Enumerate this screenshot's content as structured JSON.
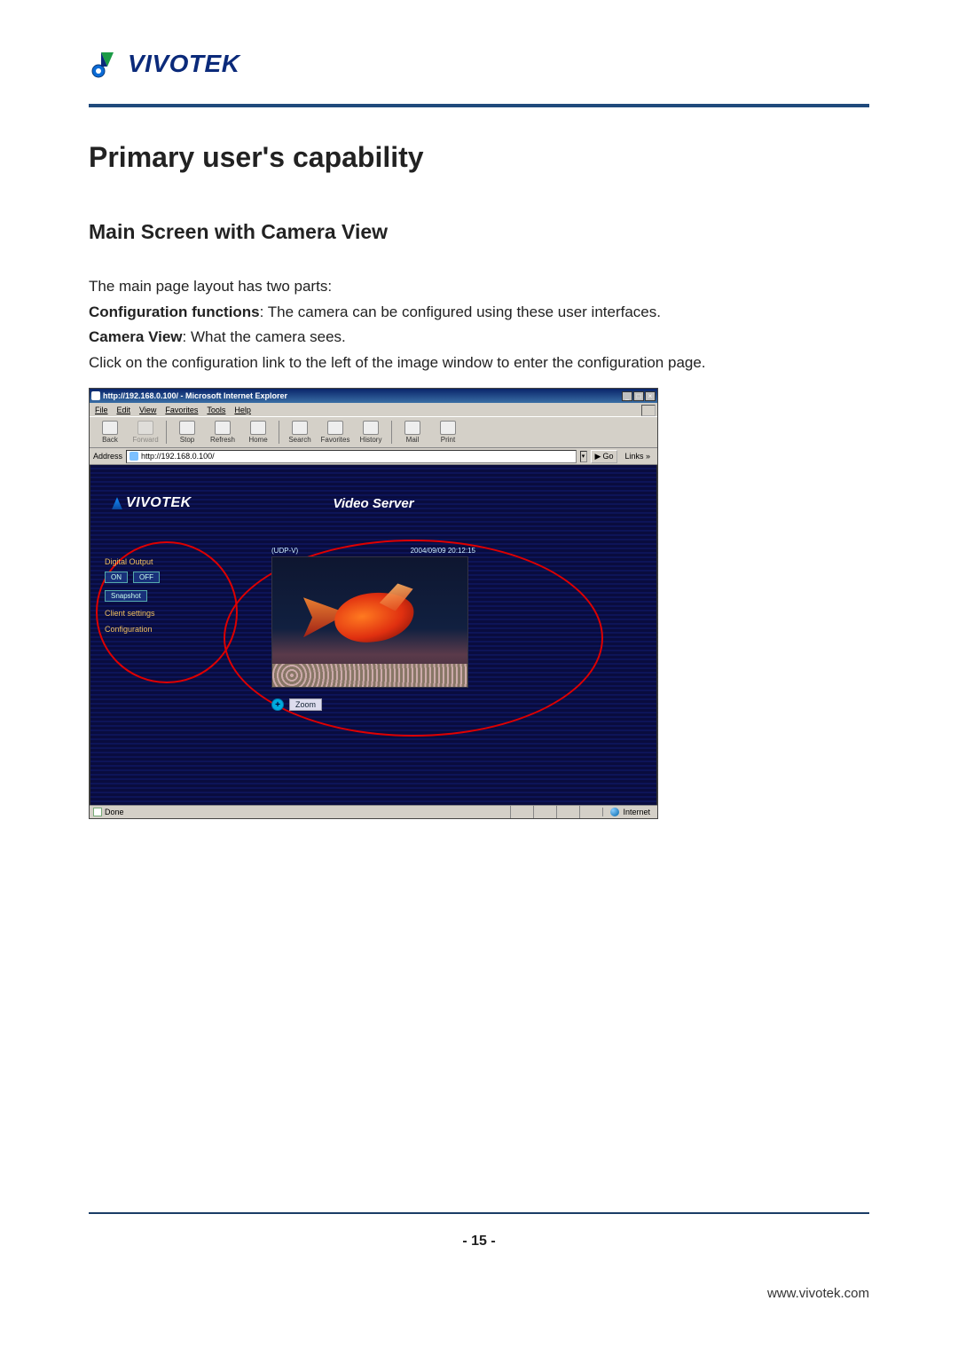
{
  "logo": {
    "text": "VIVOTEK"
  },
  "h1": "Primary user's capability",
  "h2": "Main Screen with Camera View",
  "body": {
    "p1": "The main page layout has two parts:",
    "cf_label": "Configuration functions",
    "cf_text": ": The camera can be configured using these user interfaces.",
    "cv_label": "Camera View",
    "cv_text": ": What the camera sees.",
    "p2": "Click on the configuration link to the left of the image window to enter the configuration page."
  },
  "screenshot": {
    "title": "http://192.168.0.100/ - Microsoft Internet Explorer",
    "menubar": [
      "File",
      "Edit",
      "View",
      "Favorites",
      "Tools",
      "Help"
    ],
    "toolbar": [
      {
        "label": "Back",
        "name": "back-button",
        "dis": false
      },
      {
        "label": "Forward",
        "name": "forward-button",
        "dis": true
      },
      {
        "label": "Stop",
        "name": "stop-button",
        "dis": false
      },
      {
        "label": "Refresh",
        "name": "refresh-button",
        "dis": false
      },
      {
        "label": "Home",
        "name": "home-button",
        "dis": false
      },
      {
        "label": "Search",
        "name": "search-button",
        "dis": false
      },
      {
        "label": "Favorites",
        "name": "favorites-button",
        "dis": false
      },
      {
        "label": "History",
        "name": "history-button",
        "dis": false
      },
      {
        "label": "Mail",
        "name": "mail-button",
        "dis": false
      },
      {
        "label": "Print",
        "name": "print-button",
        "dis": false
      }
    ],
    "address_label": "Address",
    "address_value": "http://192.168.0.100/",
    "go_label": "Go",
    "links_label": "Links »",
    "page": {
      "logo": "VIVOTEK",
      "title": "Video Server",
      "sidebar": {
        "digital_output": "Digital Output",
        "on": "ON",
        "off": "OFF",
        "snapshot": "Snapshot",
        "client_settings": "Client settings",
        "configuration": "Configuration"
      },
      "video": {
        "proto": "(UDP-V)",
        "timestamp": "2004/09/09 20:12:15",
        "zoom": "Zoom",
        "zoom_btn": "+"
      }
    },
    "status": {
      "done": "Done",
      "zone": "Internet"
    }
  },
  "footer": {
    "page": "- 15 -",
    "url": "www.vivotek.com"
  }
}
